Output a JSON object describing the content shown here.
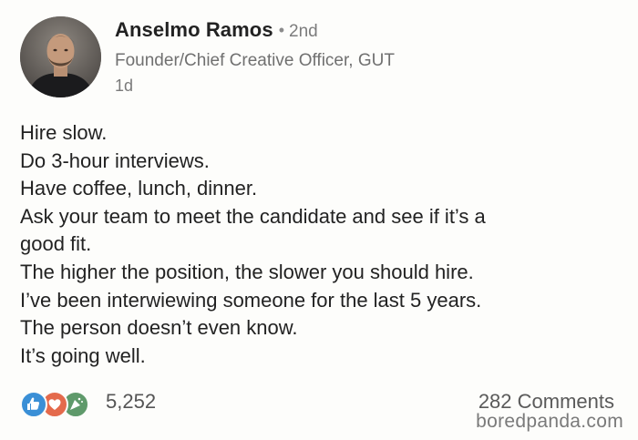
{
  "post": {
    "author": {
      "name": "Anselmo Ramos",
      "separator": "•",
      "degree": "2nd",
      "headline": "Founder/Chief Creative Officer, GUT",
      "time": "1d"
    },
    "lines": [
      "Hire slow.",
      "Do 3-hour interviews.",
      "Have coffee, lunch, dinner.",
      "Ask your team to meet the candidate and see if it’s a",
      "good fit.",
      "The higher the position, the slower you should hire.",
      "I’ve been interwiewing someone for the last 5 years.",
      "The person doesn’t even know.",
      "It’s going well."
    ],
    "reactions": {
      "icons": [
        "like-icon",
        "love-icon",
        "celebrate-icon"
      ],
      "count": "5,252"
    },
    "comments": "282 Comments"
  },
  "watermark": "boredpanda.com",
  "colors": {
    "background": "#fdfdfb",
    "like": "#3a8fd6",
    "love": "#e46a4c",
    "celebrate": "#5f9a6b"
  }
}
